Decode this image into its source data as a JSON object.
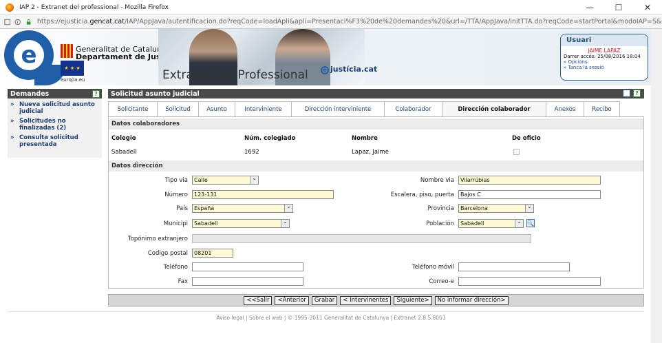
{
  "window": {
    "title": "IAP 2 - Extranet del professional - Mozilla Firefox",
    "minimize": "—",
    "maximize": "☐",
    "close": "✕"
  },
  "url": {
    "prefix": "https://ejusticia.",
    "domain": "gencat.cat",
    "rest": "/IAP/AppJava/autentificacion.do?reqCode=loadApli&apli=Presentaci%F3%20de%20demandes%20&url=/TTA/AppJava/initTTA.do?reqCode=startPortal&modoIAP=S&set-locale=ca_"
  },
  "banner": {
    "logo_letter": "e",
    "gencat_line1": "Generalitat de Catalunya",
    "gencat_line2": "Departament de Justícia",
    "eu_label": "europa.eu",
    "title": "Extranet del Professional",
    "justicia_logo_letter": "e",
    "justicia_label": "justícia.cat"
  },
  "user": {
    "header": "Usuari",
    "name": "JAIME LAPAZ",
    "last_access": "Darrer accés: 25/08/2016 18:04",
    "options": "» Opcions",
    "logout": "» Tanca la sessió"
  },
  "sidebar": {
    "header": "Demandes",
    "help": "?",
    "items": [
      {
        "arrow": "»",
        "label": "Nueva solicitud asunto judicial"
      },
      {
        "arrow": "»",
        "label": "Solicitudes no finalizadas (2)"
      },
      {
        "arrow": "»",
        "label": "Consulta solicitud presentada"
      }
    ]
  },
  "main": {
    "header": "Solicitud asunto judicial",
    "help": "?",
    "tabs": [
      {
        "label": "Solicitante"
      },
      {
        "label": "Solicitud"
      },
      {
        "label": "Asunto"
      },
      {
        "label": "Interviniente"
      },
      {
        "label": "Dirección interviniente"
      },
      {
        "label": "Colaborador"
      },
      {
        "label": "Dirección colaborador"
      },
      {
        "label": "Anexos"
      },
      {
        "label": "Recibo"
      }
    ],
    "colaboradores": {
      "section": "Datos colaboradores",
      "headers": {
        "colegio": "Colegio",
        "num": "Núm. colegiado",
        "nombre": "Nombre",
        "oficio": "De oficio"
      },
      "row": {
        "colegio": "Sabadell",
        "num": "1692",
        "nombre": "Lapaz, Jaime"
      }
    },
    "direccion": {
      "section": "Datos dirección",
      "tipo_via": {
        "label": "Tipo via",
        "value": "Calle"
      },
      "nombre_via": {
        "label": "Nombre via",
        "value": "Vilarrúbias"
      },
      "numero": {
        "label": "Número",
        "value": "123-131"
      },
      "escalera": {
        "label": "Escalera, piso, puerta",
        "value": "Bajos C"
      },
      "pais": {
        "label": "País",
        "value": "España"
      },
      "provincia": {
        "label": "Provincia",
        "value": "Barcelona"
      },
      "municipio": {
        "label": "Municipi",
        "value": "Sabadell"
      },
      "poblacion": {
        "label": "Población",
        "value": "Sabadell"
      },
      "toponimo": {
        "label": "Topónimo extranjero",
        "value": ""
      },
      "cp": {
        "label": "Codigo postal",
        "value": "08201"
      },
      "telefono": {
        "label": "Teléfono",
        "value": ""
      },
      "movil": {
        "label": "Teléfono móvil",
        "value": ""
      },
      "fax": {
        "label": "Fax",
        "value": ""
      },
      "correo": {
        "label": "Correo-e",
        "value": ""
      }
    }
  },
  "buttons": {
    "salir": "<<Salir",
    "anterior": "<Anterior",
    "grabar": "Grabar",
    "intervinientes": "< Intervinentes",
    "siguiente": "Siguiente>",
    "no_informar": "No informar dirección>"
  },
  "footer": {
    "text": "Aviso legal |  Sobre el web |  © 1995-2011 Generalitat de Catalunya |  Extranet 2.8.5.8001"
  }
}
